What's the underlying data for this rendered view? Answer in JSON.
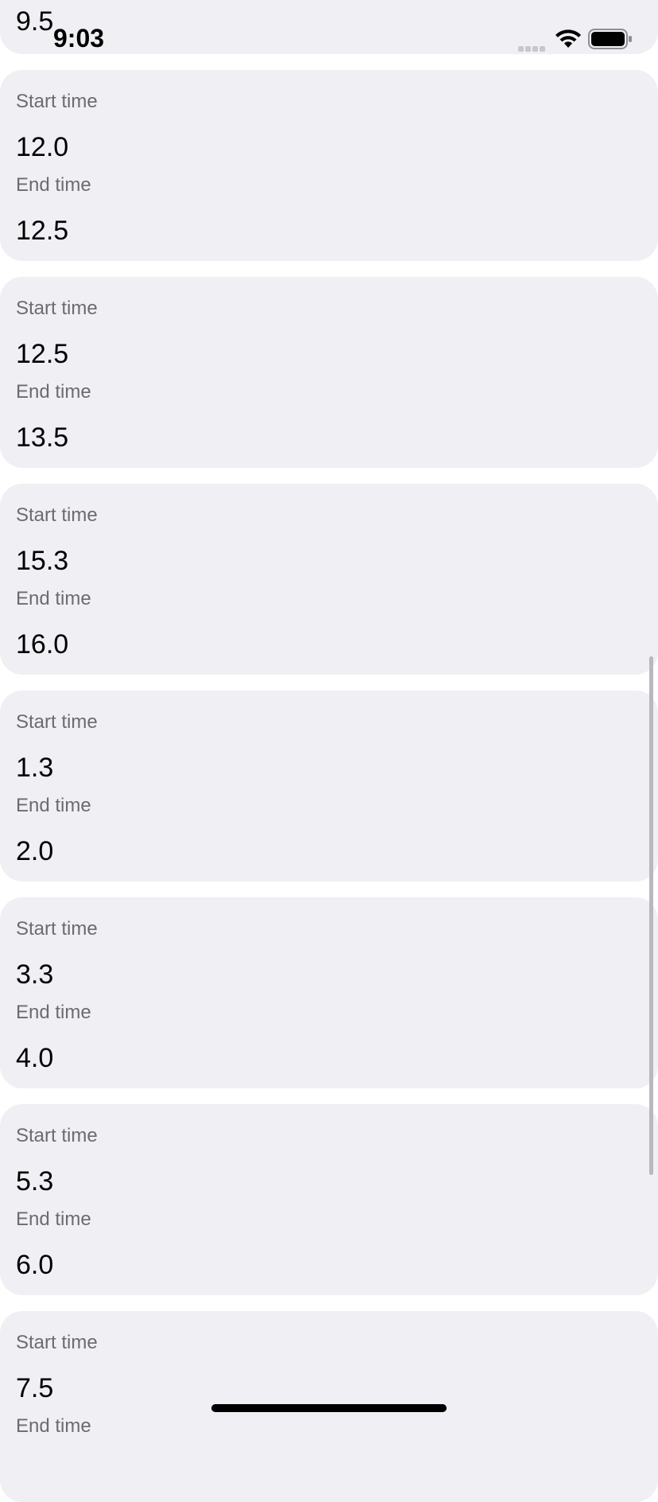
{
  "status_bar": {
    "time": "9:03"
  },
  "colors": {
    "card_background": "#efeff4",
    "label_text": "#6b6b70",
    "value_text": "#000000"
  },
  "icons": {
    "signal": "cellular-signal-icon",
    "wifi": "wifi-icon",
    "battery": "battery-icon"
  },
  "partial_card": {
    "end_value": "9.5"
  },
  "cards": [
    {
      "start_label": "Start time",
      "start_value": "12.0",
      "end_label": "End time",
      "end_value": "12.5"
    },
    {
      "start_label": "Start time",
      "start_value": "12.5",
      "end_label": "End time",
      "end_value": "13.5"
    },
    {
      "start_label": "Start time",
      "start_value": "15.3",
      "end_label": "End time",
      "end_value": "16.0"
    },
    {
      "start_label": "Start time",
      "start_value": "1.3",
      "end_label": "End time",
      "end_value": "2.0"
    },
    {
      "start_label": "Start time",
      "start_value": "3.3",
      "end_label": "End time",
      "end_value": "4.0"
    },
    {
      "start_label": "Start time",
      "start_value": "5.3",
      "end_label": "End time",
      "end_value": "6.0"
    },
    {
      "start_label": "Start time",
      "start_value": "7.5",
      "end_label": "End time",
      "end_value": ""
    }
  ]
}
